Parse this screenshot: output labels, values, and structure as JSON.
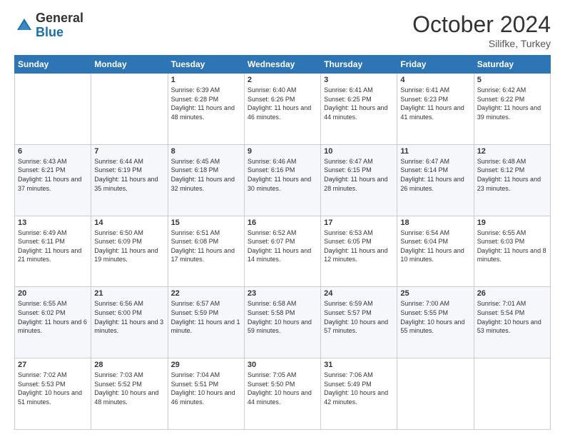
{
  "logo": {
    "general": "General",
    "blue": "Blue"
  },
  "title": "October 2024",
  "subtitle": "Silifke, Turkey",
  "days_header": [
    "Sunday",
    "Monday",
    "Tuesday",
    "Wednesday",
    "Thursday",
    "Friday",
    "Saturday"
  ],
  "weeks": [
    [
      {
        "day": "",
        "info": ""
      },
      {
        "day": "",
        "info": ""
      },
      {
        "day": "1",
        "info": "Sunrise: 6:39 AM\nSunset: 6:28 PM\nDaylight: 11 hours and 48 minutes."
      },
      {
        "day": "2",
        "info": "Sunrise: 6:40 AM\nSunset: 6:26 PM\nDaylight: 11 hours and 46 minutes."
      },
      {
        "day": "3",
        "info": "Sunrise: 6:41 AM\nSunset: 6:25 PM\nDaylight: 11 hours and 44 minutes."
      },
      {
        "day": "4",
        "info": "Sunrise: 6:41 AM\nSunset: 6:23 PM\nDaylight: 11 hours and 41 minutes."
      },
      {
        "day": "5",
        "info": "Sunrise: 6:42 AM\nSunset: 6:22 PM\nDaylight: 11 hours and 39 minutes."
      }
    ],
    [
      {
        "day": "6",
        "info": "Sunrise: 6:43 AM\nSunset: 6:21 PM\nDaylight: 11 hours and 37 minutes."
      },
      {
        "day": "7",
        "info": "Sunrise: 6:44 AM\nSunset: 6:19 PM\nDaylight: 11 hours and 35 minutes."
      },
      {
        "day": "8",
        "info": "Sunrise: 6:45 AM\nSunset: 6:18 PM\nDaylight: 11 hours and 32 minutes."
      },
      {
        "day": "9",
        "info": "Sunrise: 6:46 AM\nSunset: 6:16 PM\nDaylight: 11 hours and 30 minutes."
      },
      {
        "day": "10",
        "info": "Sunrise: 6:47 AM\nSunset: 6:15 PM\nDaylight: 11 hours and 28 minutes."
      },
      {
        "day": "11",
        "info": "Sunrise: 6:47 AM\nSunset: 6:14 PM\nDaylight: 11 hours and 26 minutes."
      },
      {
        "day": "12",
        "info": "Sunrise: 6:48 AM\nSunset: 6:12 PM\nDaylight: 11 hours and 23 minutes."
      }
    ],
    [
      {
        "day": "13",
        "info": "Sunrise: 6:49 AM\nSunset: 6:11 PM\nDaylight: 11 hours and 21 minutes."
      },
      {
        "day": "14",
        "info": "Sunrise: 6:50 AM\nSunset: 6:09 PM\nDaylight: 11 hours and 19 minutes."
      },
      {
        "day": "15",
        "info": "Sunrise: 6:51 AM\nSunset: 6:08 PM\nDaylight: 11 hours and 17 minutes."
      },
      {
        "day": "16",
        "info": "Sunrise: 6:52 AM\nSunset: 6:07 PM\nDaylight: 11 hours and 14 minutes."
      },
      {
        "day": "17",
        "info": "Sunrise: 6:53 AM\nSunset: 6:05 PM\nDaylight: 11 hours and 12 minutes."
      },
      {
        "day": "18",
        "info": "Sunrise: 6:54 AM\nSunset: 6:04 PM\nDaylight: 11 hours and 10 minutes."
      },
      {
        "day": "19",
        "info": "Sunrise: 6:55 AM\nSunset: 6:03 PM\nDaylight: 11 hours and 8 minutes."
      }
    ],
    [
      {
        "day": "20",
        "info": "Sunrise: 6:55 AM\nSunset: 6:02 PM\nDaylight: 11 hours and 6 minutes."
      },
      {
        "day": "21",
        "info": "Sunrise: 6:56 AM\nSunset: 6:00 PM\nDaylight: 11 hours and 3 minutes."
      },
      {
        "day": "22",
        "info": "Sunrise: 6:57 AM\nSunset: 5:59 PM\nDaylight: 11 hours and 1 minute."
      },
      {
        "day": "23",
        "info": "Sunrise: 6:58 AM\nSunset: 5:58 PM\nDaylight: 10 hours and 59 minutes."
      },
      {
        "day": "24",
        "info": "Sunrise: 6:59 AM\nSunset: 5:57 PM\nDaylight: 10 hours and 57 minutes."
      },
      {
        "day": "25",
        "info": "Sunrise: 7:00 AM\nSunset: 5:55 PM\nDaylight: 10 hours and 55 minutes."
      },
      {
        "day": "26",
        "info": "Sunrise: 7:01 AM\nSunset: 5:54 PM\nDaylight: 10 hours and 53 minutes."
      }
    ],
    [
      {
        "day": "27",
        "info": "Sunrise: 7:02 AM\nSunset: 5:53 PM\nDaylight: 10 hours and 51 minutes."
      },
      {
        "day": "28",
        "info": "Sunrise: 7:03 AM\nSunset: 5:52 PM\nDaylight: 10 hours and 48 minutes."
      },
      {
        "day": "29",
        "info": "Sunrise: 7:04 AM\nSunset: 5:51 PM\nDaylight: 10 hours and 46 minutes."
      },
      {
        "day": "30",
        "info": "Sunrise: 7:05 AM\nSunset: 5:50 PM\nDaylight: 10 hours and 44 minutes."
      },
      {
        "day": "31",
        "info": "Sunrise: 7:06 AM\nSunset: 5:49 PM\nDaylight: 10 hours and 42 minutes."
      },
      {
        "day": "",
        "info": ""
      },
      {
        "day": "",
        "info": ""
      }
    ]
  ]
}
